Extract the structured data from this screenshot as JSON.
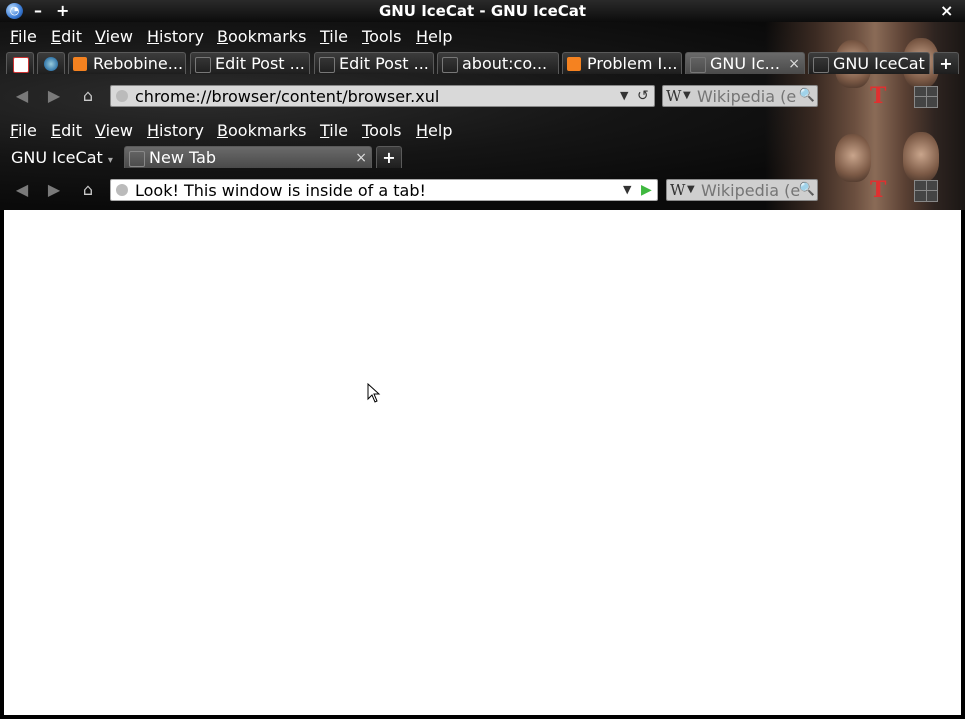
{
  "window": {
    "title": "GNU IceCat - GNU IceCat",
    "minimize": "–",
    "maximize": "+",
    "close": "×"
  },
  "outer": {
    "menu": [
      "File",
      "Edit",
      "View",
      "History",
      "Bookmarks",
      "Tile",
      "Tools",
      "Help"
    ],
    "tabs": [
      {
        "label": "",
        "icon": "gmail-icon"
      },
      {
        "label": "",
        "icon": "globe-icon"
      },
      {
        "label": "Rebobine...",
        "icon": "blogger-icon"
      },
      {
        "label": "Edit Post ...",
        "icon": "page-icon"
      },
      {
        "label": "Edit Post ...",
        "icon": "page-icon"
      },
      {
        "label": "about:co...",
        "icon": "page-icon"
      },
      {
        "label": "Problem I...",
        "icon": "blogger-icon"
      },
      {
        "label": "GNU Ic...",
        "icon": "page-icon",
        "close": "×"
      },
      {
        "label": "GNU IceCat",
        "icon": "page-icon"
      }
    ],
    "new_tab": "+",
    "url": "chrome://browser/content/browser.xul",
    "reload_icon": "↺",
    "search_engine": "W",
    "search_placeholder": "Wikipedia (en)",
    "toolbar_t": "T"
  },
  "inner": {
    "menu": [
      "File",
      "Edit",
      "View",
      "History",
      "Bookmarks",
      "Tile",
      "Tools",
      "Help"
    ],
    "tab_group": "GNU IceCat",
    "tab_group_arrow": "▾",
    "tabs": [
      {
        "label": "New Tab",
        "close": "×"
      }
    ],
    "new_tab": "+",
    "url": "Look! This window is inside of a tab!",
    "go_icon": "▶",
    "search_engine": "W",
    "search_placeholder": "Wikipedia (en)",
    "toolbar_t": "T"
  },
  "colors": {
    "go_green": "#3fb83f",
    "toolbar_t": "#e03030"
  }
}
